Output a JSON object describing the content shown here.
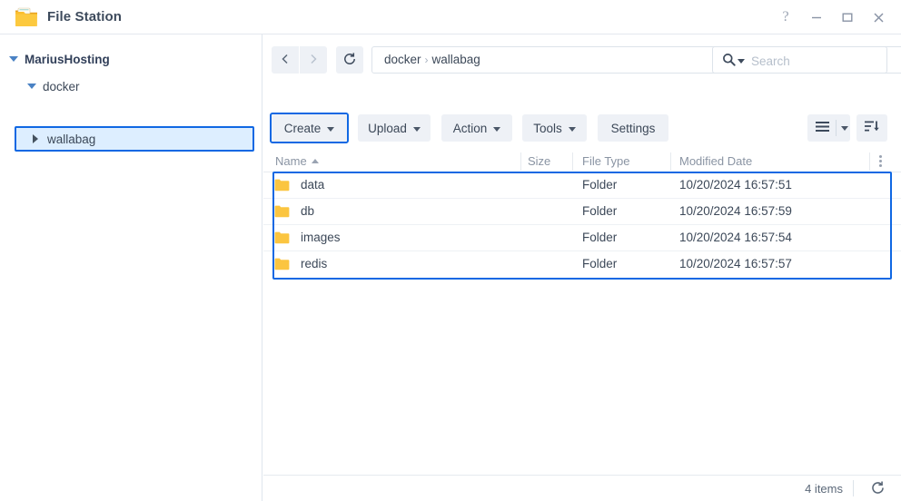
{
  "window": {
    "title": "File Station",
    "app_icon": "folder-icon",
    "controls": {
      "help": "?",
      "minimize": "minimize-icon",
      "maximize": "maximize-icon",
      "close": "close-icon"
    }
  },
  "sidebar": {
    "items": [
      {
        "label": "MariusHosting",
        "expanded": true,
        "level": 0,
        "selected": false
      },
      {
        "label": "docker",
        "expanded": true,
        "level": 1,
        "selected": false
      },
      {
        "label": "wallabag",
        "expanded": false,
        "level": 2,
        "selected": true
      }
    ]
  },
  "nav": {
    "back": "chevron-left-icon",
    "forward": "chevron-right-icon",
    "refresh": "refresh-icon",
    "path_segments": [
      "docker",
      "wallabag"
    ],
    "path_separator": "›",
    "favorite": "star-icon"
  },
  "search": {
    "icon": "search-icon",
    "placeholder": "Search",
    "value": ""
  },
  "toolbar": {
    "create_label": "Create",
    "upload_label": "Upload",
    "action_label": "Action",
    "tools_label": "Tools",
    "settings_label": "Settings",
    "view_mode_icon": "list-view-icon",
    "view_mode_dropdown": "chevron-down-icon",
    "sort_icon": "sort-descending-icon",
    "highlighted": "Create",
    "highlight_color": "#1068e3"
  },
  "table": {
    "columns": [
      "Name",
      "Size",
      "File Type",
      "Modified Date"
    ],
    "sort_column": "Name",
    "sort_direction": "asc",
    "options_icon": "kebab-menu-icon",
    "rows": [
      {
        "icon": "folder-icon",
        "name": "data",
        "size": "",
        "type": "Folder",
        "modified": "10/20/2024 16:57:51"
      },
      {
        "icon": "folder-icon",
        "name": "db",
        "size": "",
        "type": "Folder",
        "modified": "10/20/2024 16:57:59"
      },
      {
        "icon": "folder-icon",
        "name": "images",
        "size": "",
        "type": "Folder",
        "modified": "10/20/2024 16:57:54"
      },
      {
        "icon": "folder-icon",
        "name": "redis",
        "size": "",
        "type": "Folder",
        "modified": "10/20/2024 16:57:57"
      }
    ]
  },
  "status": {
    "items_count": "4 items",
    "refresh_icon": "refresh-icon"
  },
  "colors": {
    "highlight": "#1068e3",
    "selection_fill": "#ddeeff",
    "folder": "#fbc540",
    "toolbar_button": "#eef1f6"
  }
}
